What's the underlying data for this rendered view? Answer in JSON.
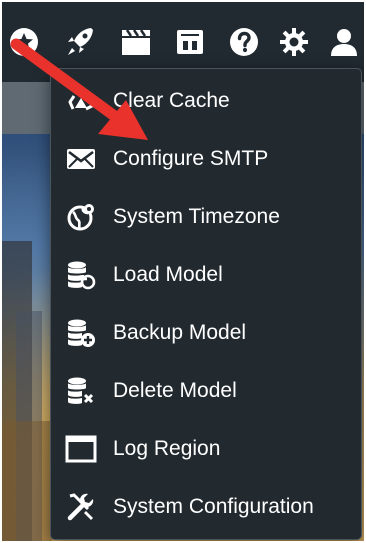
{
  "topbar": {
    "icons": [
      "star-icon",
      "rocket-icon",
      "clapperboard-icon",
      "shop-icon",
      "help-icon",
      "gear-icon",
      "user-icon"
    ]
  },
  "menu": {
    "items": [
      {
        "label": "Clear Cache",
        "icon": "recycle-icon"
      },
      {
        "label": "Configure SMTP",
        "icon": "envelope-icon"
      },
      {
        "label": "System Timezone",
        "icon": "globe-icon"
      },
      {
        "label": "Load Model",
        "icon": "database-restore-icon"
      },
      {
        "label": "Backup Model",
        "icon": "database-add-icon"
      },
      {
        "label": "Delete Model",
        "icon": "database-delete-icon"
      },
      {
        "label": "Log Region",
        "icon": "window-icon"
      },
      {
        "label": "System Configuration",
        "icon": "wrench-screwdriver-icon"
      }
    ]
  },
  "colors": {
    "arrow": "#e8322b",
    "menu_bg": "#22292f",
    "topbar_bg": "#212a31",
    "text": "#ffffff"
  }
}
